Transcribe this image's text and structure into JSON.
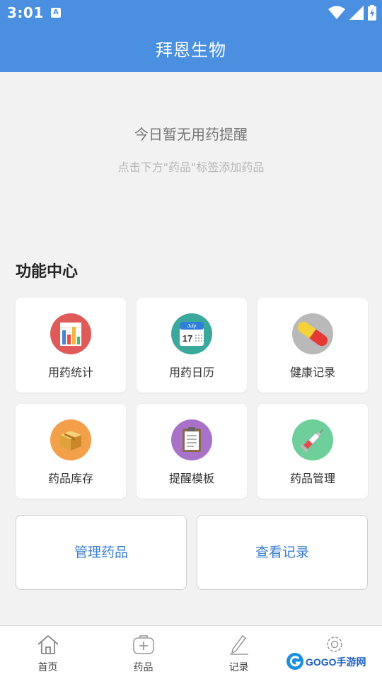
{
  "status_bar": {
    "time": "3:01",
    "notification_badge": "A"
  },
  "header": {
    "title": "拜恩生物"
  },
  "empty_state": {
    "title": "今日暂无用药提醒",
    "hint": "点击下方\"药品\"标签添加药品"
  },
  "function_center": {
    "title": "功能中心",
    "items": [
      {
        "label": "用药统计",
        "icon": "bar-chart-icon",
        "color": "#e05a5a"
      },
      {
        "label": "用药日历",
        "icon": "calendar-icon",
        "color": "#3aa89a",
        "calendar_month": "July",
        "calendar_day": "17"
      },
      {
        "label": "健康记录",
        "icon": "pill-capsule-icon",
        "color": "#b9b9b9"
      },
      {
        "label": "药品库存",
        "icon": "package-box-icon",
        "color": "#f4a04a"
      },
      {
        "label": "提醒模板",
        "icon": "clipboard-icon",
        "color": "#a872c8"
      },
      {
        "label": "药品管理",
        "icon": "syringe-icon",
        "color": "#6fcf9a"
      }
    ]
  },
  "actions": {
    "manage_drugs": "管理药品",
    "view_records": "查看记录"
  },
  "bottom_nav": {
    "items": [
      {
        "label": "首页",
        "icon": "home-icon"
      },
      {
        "label": "药品",
        "icon": "medical-kit-icon"
      },
      {
        "label": "记录",
        "icon": "pencil-icon"
      },
      {
        "label": "",
        "icon": "settings-icon"
      }
    ]
  },
  "watermark": {
    "text": "GOGO手游网"
  },
  "colors": {
    "primary": "#4a8fe0",
    "accent_text": "#3a7ecf",
    "background": "#f2f2f2"
  }
}
